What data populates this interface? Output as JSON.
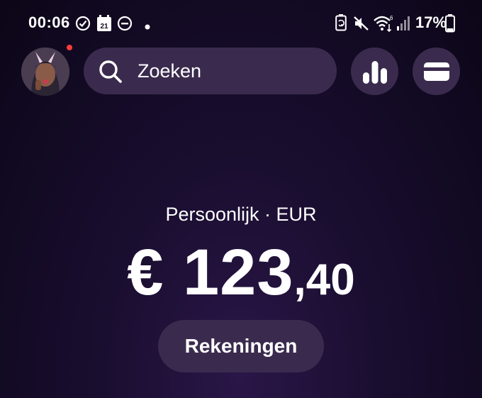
{
  "status_bar": {
    "time": "00:06",
    "calendar_day": "21",
    "battery_percent": "17%",
    "icons": [
      "check-circle-icon",
      "calendar-icon",
      "dnd-icon",
      "dot-icon",
      "battery-saver-icon",
      "mute-icon",
      "wifi-icon",
      "signal-icon",
      "battery-icon"
    ]
  },
  "header": {
    "search_placeholder": "Zoeken",
    "has_notification": true
  },
  "balance": {
    "account_label": "Persoonlijk · EUR",
    "amount_main": "€ 123",
    "amount_cents": ",40"
  },
  "accounts_button": {
    "label": "Rekeningen"
  },
  "colors": {
    "background": "#12091f",
    "surface": "#3a2b4e",
    "text": "#ffffff",
    "notification": "#ff3b3b"
  }
}
